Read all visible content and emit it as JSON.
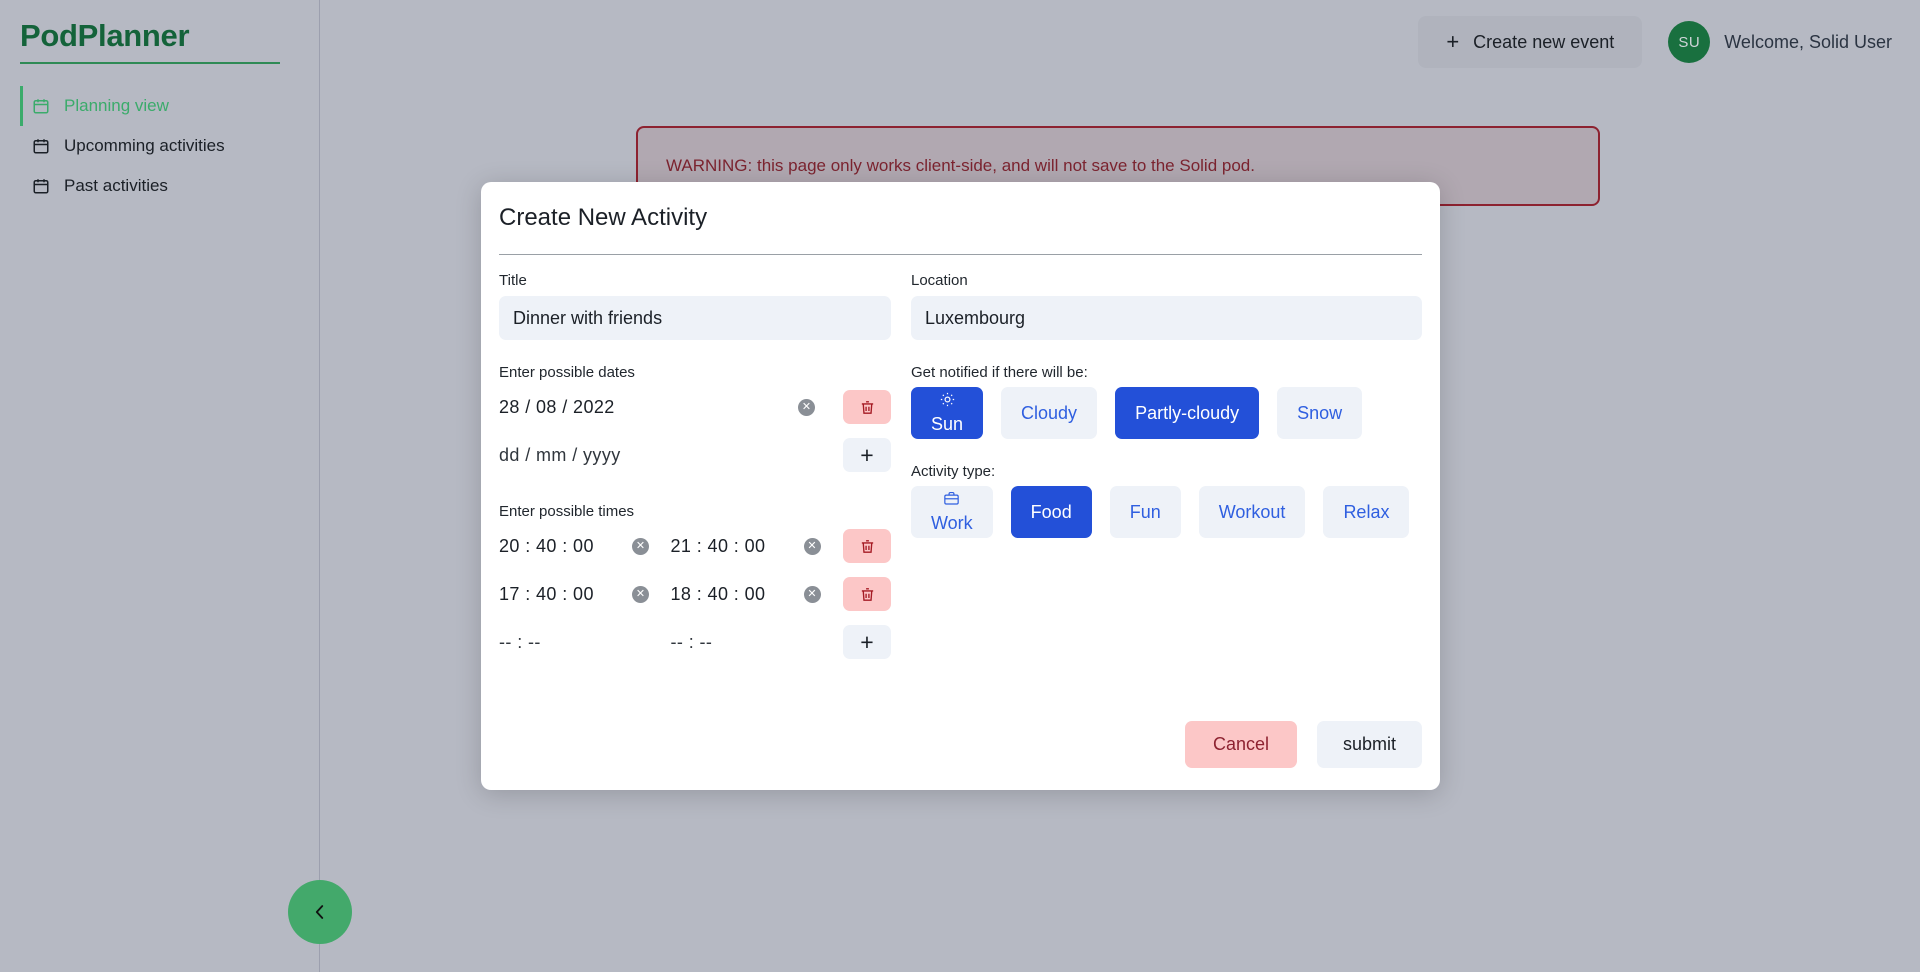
{
  "sidebar": {
    "brand": "PodPlanner",
    "items": [
      {
        "label": "Planning view",
        "icon": "calendar-icon",
        "active": true
      },
      {
        "label": "Upcomming activities",
        "icon": "calendar-icon",
        "active": false
      },
      {
        "label": "Past activities",
        "icon": "calendar-icon",
        "active": false
      }
    ],
    "collapse_icon": "chevron-left-icon"
  },
  "header": {
    "create_label": "Create new event",
    "create_icon": "plus-icon",
    "avatar_initials": "SU",
    "welcome": "Welcome, Solid User"
  },
  "warning": {
    "text": "WARNING: this page only works client-side, and will not save to the Solid pod.",
    "border_color": "#8d2230",
    "text_color": "#7c2430"
  },
  "modal": {
    "title": "Create New Activity",
    "title_field": {
      "label": "Title",
      "value": "Dinner with friends",
      "placeholder": "Title"
    },
    "location_field": {
      "label": "Location",
      "value": "Luxembourg",
      "placeholder": "Location"
    },
    "dates": {
      "label": "Enter possible dates",
      "rows": [
        {
          "value": "28 / 08 / 2022",
          "is_placeholder": false,
          "clear_icon": "clear-circle-icon",
          "action_icon": "trash-icon"
        },
        {
          "value": "dd / mm / yyyy",
          "is_placeholder": true,
          "clear_icon": null,
          "action_icon": "plus-icon"
        }
      ]
    },
    "times": {
      "label": "Enter possible times",
      "rows": [
        {
          "start": "20 : 40 : 00",
          "end": "21 : 40 : 00",
          "is_placeholder": false,
          "action_icon": "trash-icon"
        },
        {
          "start": "17 : 40 : 00",
          "end": "18 : 40 : 00",
          "is_placeholder": false,
          "action_icon": "trash-icon"
        },
        {
          "start": "-- : --",
          "end": "-- : --",
          "is_placeholder": true,
          "action_icon": "plus-icon"
        }
      ]
    },
    "weather": {
      "label": "Get notified if there will be:",
      "options": [
        {
          "label": "Sun",
          "selected": true,
          "icon": "sun-icon"
        },
        {
          "label": "Cloudy",
          "selected": false,
          "icon": null
        },
        {
          "label": "Partly-cloudy",
          "selected": true,
          "icon": null
        },
        {
          "label": "Snow",
          "selected": false,
          "icon": null
        }
      ]
    },
    "activity_type": {
      "label": "Activity type:",
      "options": [
        {
          "label": "Work",
          "selected": false,
          "icon": "briefcase-icon"
        },
        {
          "label": "Food",
          "selected": true,
          "icon": null
        },
        {
          "label": "Fun",
          "selected": false,
          "icon": null
        },
        {
          "label": "Workout",
          "selected": false,
          "icon": null
        },
        {
          "label": "Relax",
          "selected": false,
          "icon": null
        }
      ]
    },
    "cancel_label": "Cancel",
    "submit_label": "submit"
  },
  "colors": {
    "brand_green": "#14633a",
    "accent_blue": "#2350d8",
    "chip_blue_text": "#2f5fe0",
    "danger_red": "#8d2230",
    "page_bg": "#b6b9c3"
  }
}
